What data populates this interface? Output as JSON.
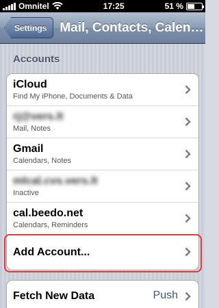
{
  "status_bar": {
    "carrier": "Omnitel",
    "time": "17:25",
    "battery_percent": "51 %",
    "battery_level": 0.51
  },
  "nav": {
    "back_label": "Settings",
    "title": "Mail, Contacts, Calendars"
  },
  "accounts": {
    "header": "Accounts",
    "items": [
      {
        "title": "iCloud",
        "subtitle": "Find My iPhone, Documents & Data",
        "blurred": false
      },
      {
        "title": "rj@vers.lt",
        "subtitle": "Mail, Notes",
        "blurred": true
      },
      {
        "title": "Gmail",
        "subtitle": "Calendars, Notes",
        "blurred": false
      },
      {
        "title": "mlcal.cvs.vers.lt",
        "subtitle": "Inactive",
        "blurred": true
      },
      {
        "title": "cal.beedo.net",
        "subtitle": "Calendars, Reminders",
        "blurred": false
      }
    ],
    "add_label": "Add Account..."
  },
  "fetch": {
    "label": "Fetch New Data",
    "value": "Push"
  },
  "colors": {
    "highlight": "#e53a3a",
    "detail_text": "#3d5589"
  },
  "icons": {
    "wifi": "wifi-icon",
    "signal": "signal-strength-icon",
    "battery": "battery-icon",
    "disclosure": "chevron-right-icon"
  }
}
